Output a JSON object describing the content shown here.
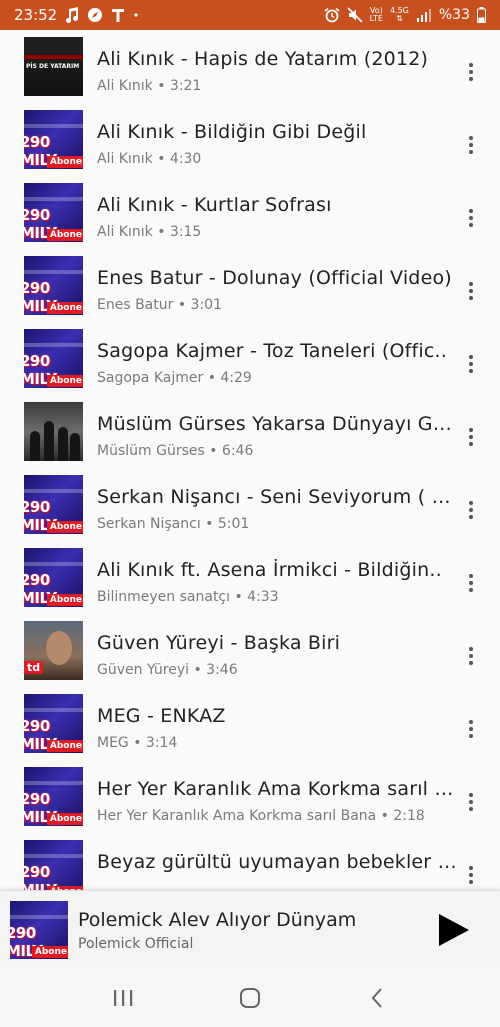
{
  "status_bar": {
    "time": "23:52",
    "battery": "%33",
    "network_top": "Vo)",
    "network_bottom": "LTE",
    "signal_label": "4.5G"
  },
  "thumb_text": {
    "mily": "290 MILY",
    "abone": "Abone",
    "dark_title": "PİS DE YATARIM",
    "man_tag": "td"
  },
  "songs": [
    {
      "title": "Ali Kınık - Hapis de Yatarım (2012)",
      "subtitle": "Ali Kınık • 3:21",
      "thumb": "dark"
    },
    {
      "title": "Ali Kınık - Bildiğin Gibi Değil",
      "subtitle": "Ali Kınık • 4:30",
      "thumb": "mily"
    },
    {
      "title": "Ali Kınık - Kurtlar Sofrası",
      "subtitle": "Ali Kınık • 3:15",
      "thumb": "mily"
    },
    {
      "title": "Enes Batur - Dolunay (Official Video)",
      "subtitle": "Enes Batur • 3:01",
      "thumb": "mily"
    },
    {
      "title": "Sagopa Kajmer - Toz Taneleri (Offic..",
      "subtitle": "Sagopa Kajmer • 4:29",
      "thumb": "mily"
    },
    {
      "title": "Müslüm Gürses Yakarsa Dünyayı Gar..",
      "subtitle": "Müslüm Gürses • 6:46",
      "thumb": "band"
    },
    {
      "title": "Serkan Nişancı - Seni Seviyorum ( C..",
      "subtitle": "Serkan Nişancı • 5:01",
      "thumb": "mily"
    },
    {
      "title": "Ali Kınık ft. Asena İrmikci - Bildiğin..",
      "subtitle": "Bilinmeyen sanatçı • 4:33",
      "thumb": "mily"
    },
    {
      "title": "Güven Yüreyi - Başka Biri",
      "subtitle": "Güven Yüreyi • 3:46",
      "thumb": "man"
    },
    {
      "title": "MEG - ENKAZ",
      "subtitle": "MEG • 3:14",
      "thumb": "mily"
    },
    {
      "title": "Her Yer Karanlık Ama Korkma sarıl B..",
      "subtitle": "Her Yer Karanlık Ama Korkma sarıl Bana • 2:18",
      "thumb": "mily"
    },
    {
      "title": "Beyaz gürültü uyumayan bebekler iç..",
      "subtitle": "",
      "thumb": "mily"
    }
  ],
  "now_playing": {
    "title": "Polemick  Alev Alıyor Dünyam",
    "artist": "Polemick Official"
  },
  "icons": {
    "more": "more-vertical-icon",
    "play": "play-icon",
    "nav_recent": "recent-apps-icon",
    "nav_home": "home-icon",
    "nav_back": "back-icon"
  },
  "colors": {
    "status_bar_bg": "#c8501e",
    "list_bg": "#fafafa",
    "title_text": "#222222",
    "subtitle_text": "#7a7a7a"
  }
}
